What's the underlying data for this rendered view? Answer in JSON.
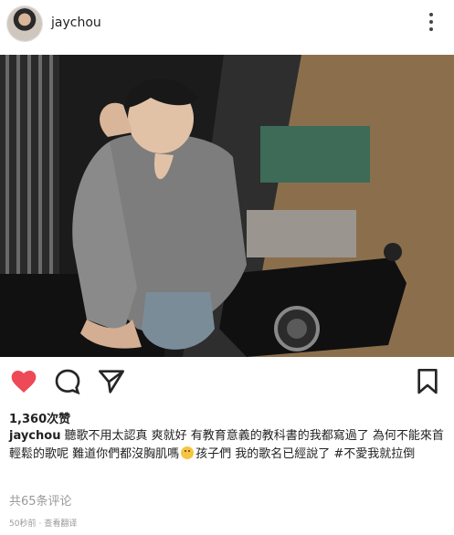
{
  "header": {
    "username": "jaychou"
  },
  "post": {
    "likes_label": "1,360次赞",
    "author": "jaychou",
    "caption_part1": "聽歌不用太認真 爽就好 有教育意義的教科書的我都寫過了 為何不能來首輕鬆的歌呢 難道你們都沒胸肌嗎",
    "caption_part2": "孩子們 我的歌名已經說了 #不愛我就拉倒",
    "comments_label": "共65条评论",
    "time_label": "50秒前",
    "see_translation_label": "查看翻译"
  },
  "colors": {
    "like": "#ed4956",
    "text": "#262626",
    "muted": "#999999"
  },
  "icons": {
    "header_more": "more-vertical-icon",
    "like": "heart-filled-icon",
    "comment": "comment-bubble-icon",
    "share": "paper-plane-icon",
    "save": "bookmark-icon"
  }
}
